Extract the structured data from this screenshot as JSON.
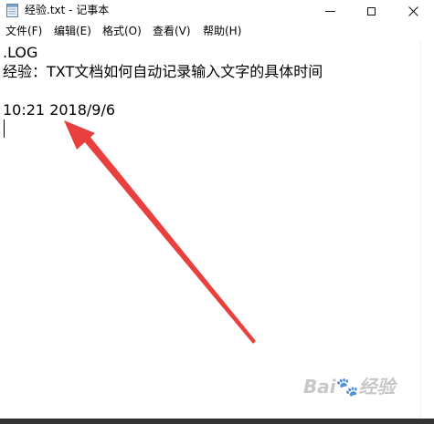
{
  "window": {
    "title": "经验.txt - 记事本"
  },
  "menu": {
    "items": [
      "文件(F)",
      "编辑(E)",
      "格式(O)",
      "查看(V)",
      "帮助(H)"
    ]
  },
  "editor": {
    "lines": [
      ".LOG",
      "经验：TXT文档如何自动记录输入文字的具体时间",
      "",
      "10:21 2018/9/6"
    ]
  },
  "annotation": {
    "arrow_color": "#e8403f"
  },
  "watermark": {
    "text_left": "Bai",
    "text_right": "经验"
  },
  "icons": {
    "app": "notepad-icon",
    "minimize": "minimize-icon",
    "maximize": "maximize-icon",
    "close": "close-icon"
  }
}
